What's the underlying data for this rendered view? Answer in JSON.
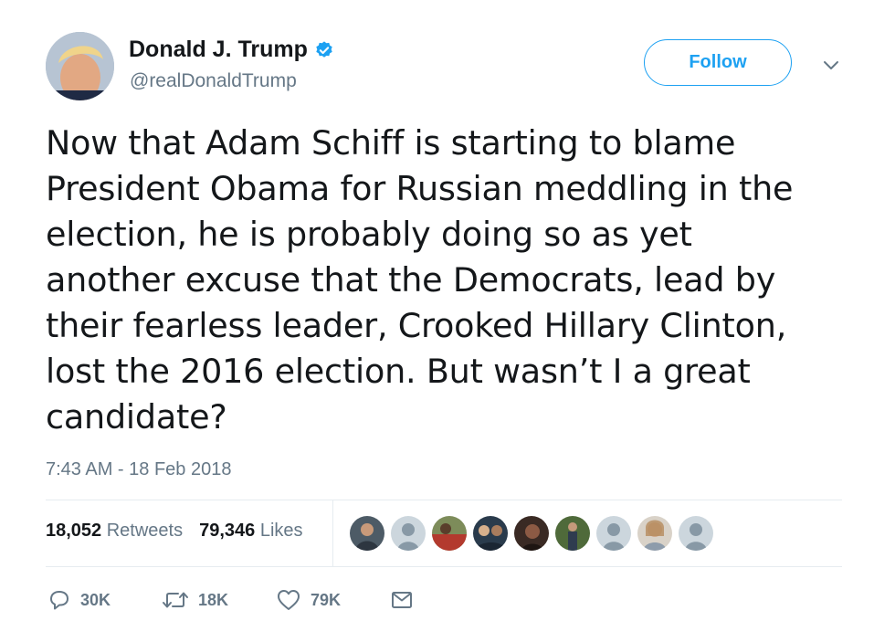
{
  "tweet": {
    "author": {
      "display_name": "Donald J. Trump",
      "handle": "@realDonaldTrump",
      "verified": true
    },
    "follow_label": "Follow",
    "text": "Now that Adam Schiff is starting to blame\nPresident Obama for Russian meddling in the\nelection, he is probably doing so as yet\nanother excuse that the Democrats, lead by\ntheir fearless leader, Crooked Hillary Clinton,\nlost the 2016 election. But wasn’t I a great\ncandidate?",
    "timestamp": "7:43 AM - 18 Feb 2018",
    "stats": {
      "retweets_count": "18,052",
      "retweets_label": "Retweets",
      "likes_count": "79,346",
      "likes_label": "Likes"
    },
    "facepile": [
      "photo",
      "default",
      "photo",
      "photo",
      "photo",
      "photo",
      "default",
      "photo",
      "default"
    ],
    "actions": {
      "reply_count": "30K",
      "retweet_count": "18K",
      "like_count": "79K"
    }
  },
  "colors": {
    "accent": "#1da1f2",
    "text": "#14171a",
    "muted": "#657786",
    "divider": "#e6ecf0"
  },
  "icons": [
    "verified-badge-icon",
    "chevron-down-icon",
    "reply-icon",
    "retweet-icon",
    "heart-icon",
    "message-icon"
  ]
}
